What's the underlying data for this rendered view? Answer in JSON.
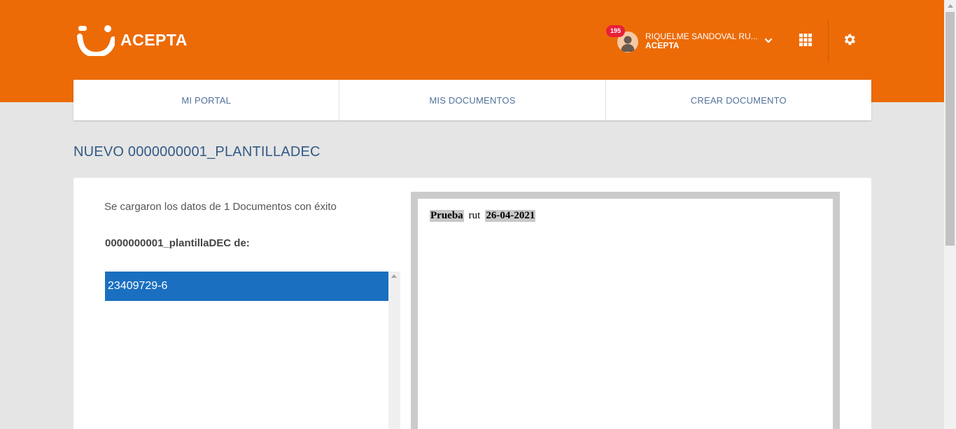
{
  "header": {
    "logo_text": "ACEPTA",
    "notification_count": "195",
    "user_name": "RIQUELME SANDOVAL RU...",
    "user_org": "ACEPTA",
    "icons": [
      "user-avatar-icon",
      "chevron-down-icon",
      "apps-grid-icon",
      "gear-icon"
    ],
    "accent_color": "#ec6b06"
  },
  "tabs": [
    {
      "label": "MI PORTAL"
    },
    {
      "label": "MIS DOCUMENTOS"
    },
    {
      "label": "CREAR DOCUMENTO"
    }
  ],
  "page": {
    "title": "NUEVO 0000000001_PLANTILLADEC"
  },
  "main": {
    "status_message": "Se cargaron los datos de 1 Documentos con éxito",
    "document_label": "0000000001_plantillaDEC de:",
    "list": [
      {
        "value": "23409729-6",
        "selected": true
      }
    ],
    "selected_color": "#1a6fc0"
  },
  "preview": {
    "word1": "Prueba",
    "word2": "rut",
    "word3": "26-04-2021"
  }
}
